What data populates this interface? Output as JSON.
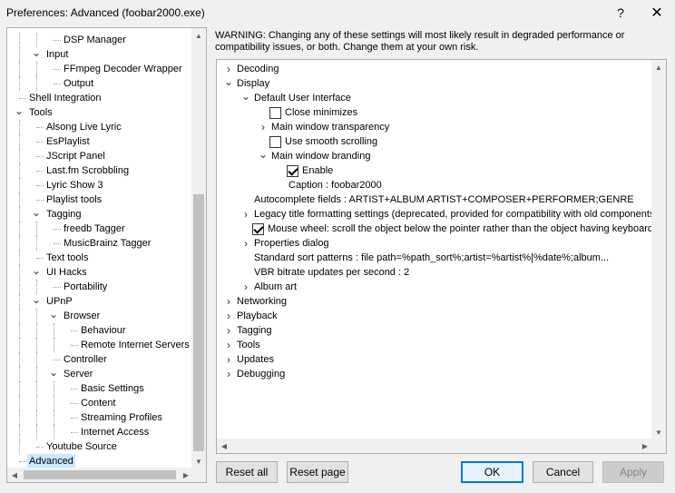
{
  "window": {
    "title": "Preferences: Advanced (foobar2000.exe)",
    "help_glyph": "?",
    "close_glyph": "✕"
  },
  "left_tree": {
    "items": [
      {
        "label": "DSP Manager"
      },
      {
        "label": "Input"
      },
      {
        "label": "FFmpeg Decoder Wrapper"
      },
      {
        "label": "Output"
      },
      {
        "label": "Shell Integration"
      },
      {
        "label": "Tools"
      },
      {
        "label": "Alsong Live Lyric"
      },
      {
        "label": "EsPlaylist"
      },
      {
        "label": "JScript Panel"
      },
      {
        "label": "Last.fm Scrobbling"
      },
      {
        "label": "Lyric Show 3"
      },
      {
        "label": "Playlist tools"
      },
      {
        "label": "Tagging"
      },
      {
        "label": "freedb Tagger"
      },
      {
        "label": "MusicBrainz Tagger"
      },
      {
        "label": "Text tools"
      },
      {
        "label": "UI Hacks"
      },
      {
        "label": "Portability"
      },
      {
        "label": "UPnP"
      },
      {
        "label": "Browser"
      },
      {
        "label": "Behaviour"
      },
      {
        "label": "Remote Internet Servers"
      },
      {
        "label": "Controller"
      },
      {
        "label": "Server"
      },
      {
        "label": "Basic Settings"
      },
      {
        "label": "Content"
      },
      {
        "label": "Streaming Profiles"
      },
      {
        "label": "Internet Access"
      },
      {
        "label": "Youtube Source"
      },
      {
        "label": "Advanced"
      }
    ]
  },
  "warning": "WARNING: Changing any of these settings will most likely result in degraded performance or compatibility issues, or both. Change them at your own risk.",
  "advanced_tree": {
    "items": [
      {
        "label": "Decoding"
      },
      {
        "label": "Display"
      },
      {
        "label": "Default User Interface"
      },
      {
        "label": "Close minimizes",
        "checked": false
      },
      {
        "label": "Main window transparency"
      },
      {
        "label": "Use smooth scrolling",
        "checked": false
      },
      {
        "label": "Main window branding"
      },
      {
        "label": "Enable",
        "checked": true
      },
      {
        "label": "Caption : foobar2000"
      },
      {
        "label": "Autocomplete fields : ARTIST+ALBUM ARTIST+COMPOSER+PERFORMER;GENRE"
      },
      {
        "label": "Legacy title formatting settings (deprecated, provided for compatibility with old components on"
      },
      {
        "label": "Mouse wheel: scroll the object below the pointer rather than the object having keyboard fo",
        "checked": true
      },
      {
        "label": "Properties dialog"
      },
      {
        "label": "Standard sort patterns : file path=%path_sort%;artist=%artist%|%date%;album..."
      },
      {
        "label": "VBR bitrate updates per second : 2"
      },
      {
        "label": "Album art"
      },
      {
        "label": "Networking"
      },
      {
        "label": "Playback"
      },
      {
        "label": "Tagging"
      },
      {
        "label": "Tools"
      },
      {
        "label": "Updates"
      },
      {
        "label": "Debugging"
      }
    ]
  },
  "buttons": {
    "reset_all": "Reset all",
    "reset_page": "Reset page",
    "ok": "OK",
    "cancel": "Cancel",
    "apply": "Apply"
  },
  "glyphs": {
    "expanded": "⌄",
    "collapsed": "›",
    "arrow_up": "▲",
    "arrow_down": "▼",
    "arrow_left": "◀",
    "arrow_right": "▶"
  }
}
